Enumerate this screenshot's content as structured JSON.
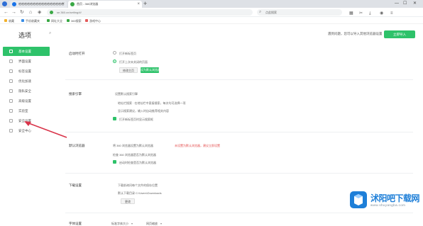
{
  "browser": {
    "tabs": [
      {
        "label": "哈哈哈哈哈哈哈哈哈哈哈哈哈哈哈哈"
      },
      {
        "label": "首页 - 360浏览器"
      }
    ],
    "new_tab_label": "+",
    "address": "se.360.cn/setting/#/",
    "search_placeholder": "点此搜索",
    "bookmarks": [
      "收藏",
      "手机收藏夹",
      "网址大全",
      "360搜索",
      "游戏中心"
    ]
  },
  "page": {
    "title": "选项",
    "search_icon": "⌕",
    "hint": "遇到问题，您可以导入其他浏览器设置",
    "import_button": "立即导入"
  },
  "sidebar": {
    "items": [
      {
        "label": "基本设置",
        "active": true
      },
      {
        "label": "界面设置",
        "active": false
      },
      {
        "label": "标签设置",
        "active": false
      },
      {
        "label": "优化加速",
        "active": false
      },
      {
        "label": "隐私安全",
        "active": false
      },
      {
        "label": "高级设置",
        "active": false
      },
      {
        "label": "实验室",
        "active": false
      },
      {
        "label": "安全设置",
        "active": false
      },
      {
        "label": "安全中心",
        "active": false
      }
    ]
  },
  "sections": {
    "startup": {
      "label": "启动时打开",
      "option1": "打开新标签页",
      "option2": "打开上次未关闭的页面",
      "set_button": "修改主页",
      "green_button": "设为默认浏览器"
    },
    "search": {
      "label": "搜索引擎",
      "row1": "设置默认搜索引擎",
      "row2": "地址栏搜索 · 在地址栏中直接搜索，每次均可选择一项",
      "row3": "显示搜索建议，输入时自动推荐相关内容",
      "row4": "打开新标签页时显示搜索框"
    },
    "default_browser": {
      "label": "默认浏览器",
      "line1": "将 360 浏览器设置为默认浏览器",
      "warning": "未设置为默认浏览器，建议立即设置",
      "line2": "检查 360 浏览器是否为默认浏览器",
      "line3": "启动时检查是否为默认浏览器"
    },
    "download": {
      "label": "下载设置",
      "line1": "下载前询问每个文件的保存位置",
      "line2": "默认下载目录 C:\\Users\\Downloads",
      "button": "更改"
    },
    "font": {
      "label": "字体设置",
      "select1": "标准字体大小",
      "select2": "网页缩放"
    }
  },
  "watermark": {
    "cn": "沭阳吧下载网",
    "en": "www.shuyangba.com"
  },
  "colors": {
    "accent": "#2ec26a",
    "warning": "#e34b4b",
    "annotation_arrow": "#d9344a"
  }
}
